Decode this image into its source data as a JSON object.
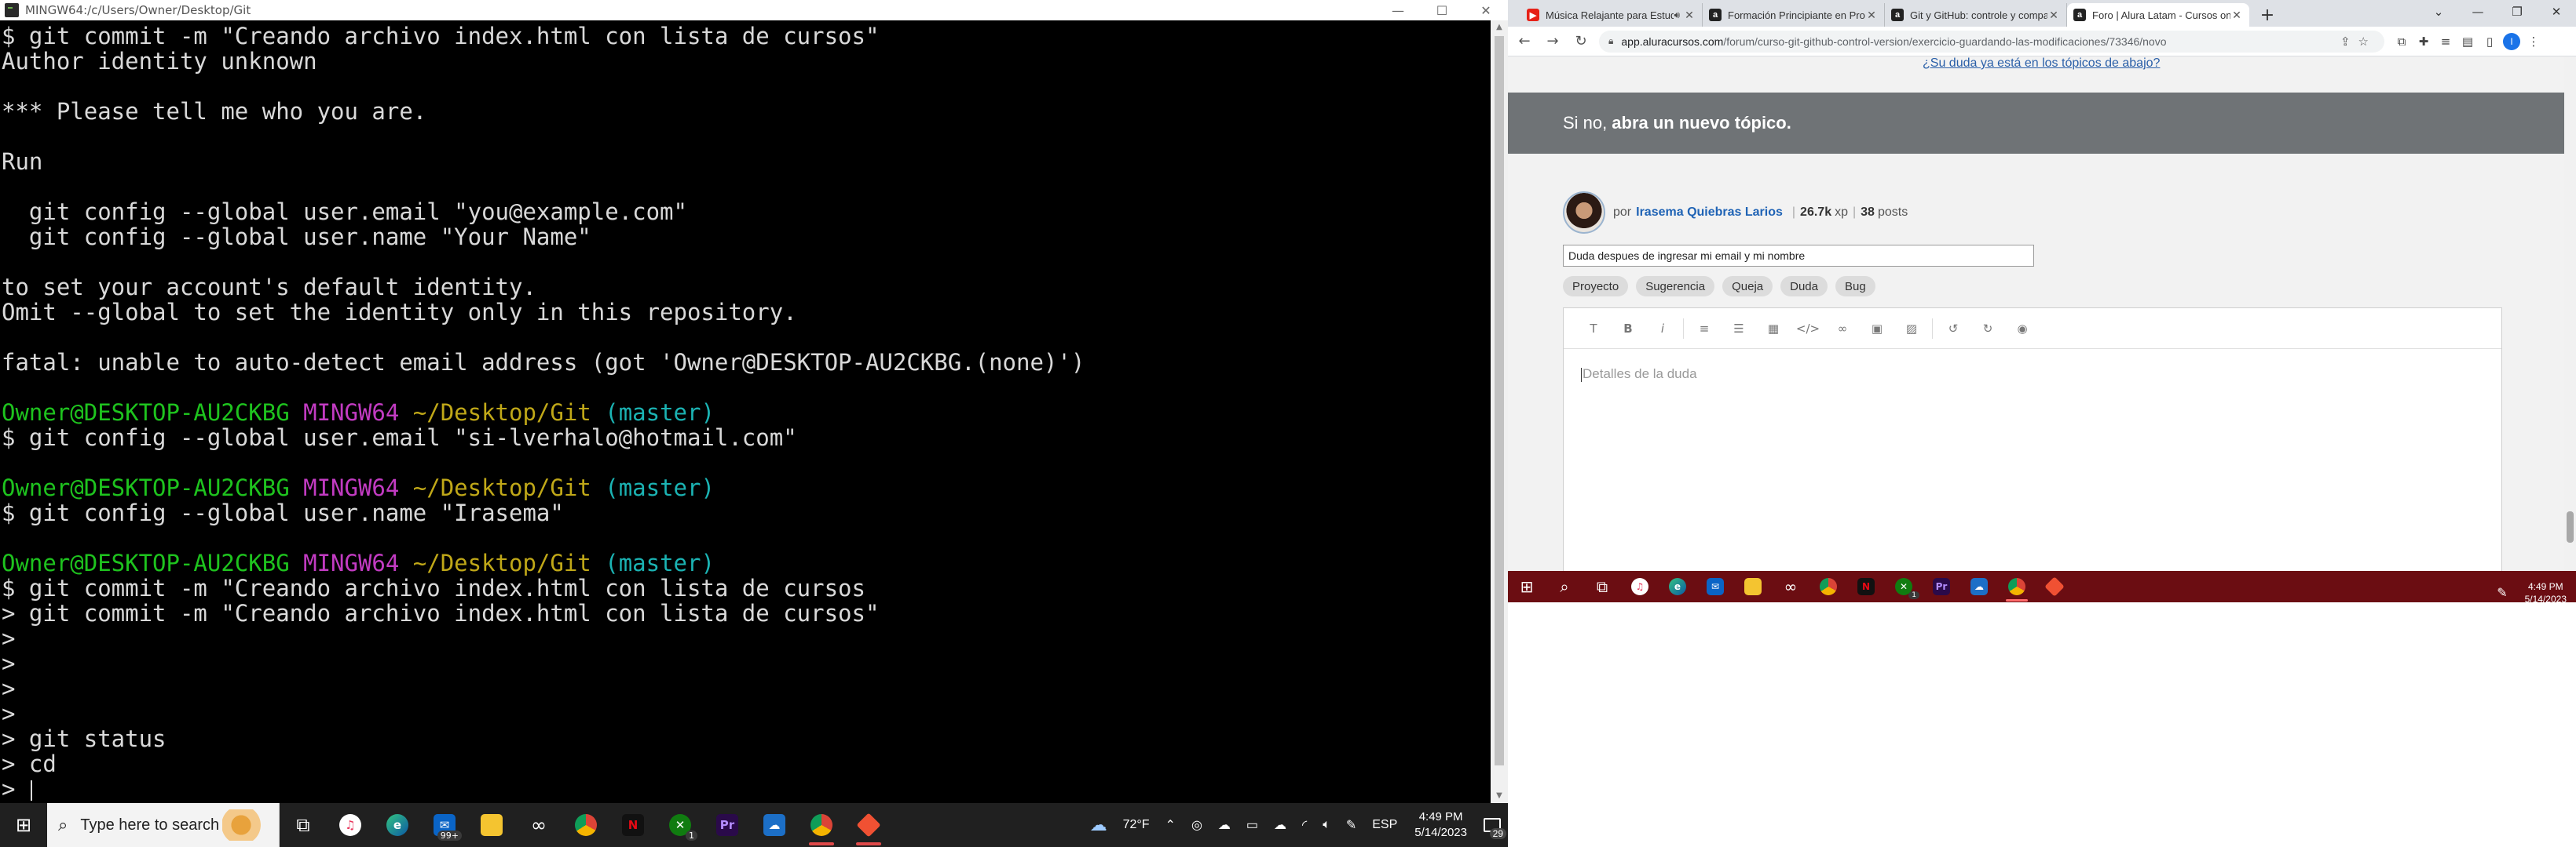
{
  "terminal": {
    "window_title": "MINGW64:/c/Users/Owner/Desktop/Git",
    "controls": {
      "minimize": "—",
      "maximize": "☐",
      "close": "✕"
    },
    "lines": [
      [
        {
          "t": "$ git commit -m \"Creando archivo index.html con lista de cursos\"",
          "c": ""
        }
      ],
      [
        {
          "t": "Author identity unknown",
          "c": ""
        }
      ],
      [
        {
          "t": "",
          "c": ""
        }
      ],
      [
        {
          "t": "*** Please tell me who you are.",
          "c": ""
        }
      ],
      [
        {
          "t": "",
          "c": ""
        }
      ],
      [
        {
          "t": "Run",
          "c": ""
        }
      ],
      [
        {
          "t": "",
          "c": ""
        }
      ],
      [
        {
          "t": "  git config --global user.email \"you@example.com\"",
          "c": ""
        }
      ],
      [
        {
          "t": "  git config --global user.name \"Your Name\"",
          "c": ""
        }
      ],
      [
        {
          "t": "",
          "c": ""
        }
      ],
      [
        {
          "t": "to set your account's default identity.",
          "c": ""
        }
      ],
      [
        {
          "t": "Omit --global to set the identity only in this repository.",
          "c": ""
        }
      ],
      [
        {
          "t": "",
          "c": ""
        }
      ],
      [
        {
          "t": "fatal: unable to auto-detect email address (got 'Owner@DESKTOP-AU2CKBG.(none)')",
          "c": ""
        }
      ],
      [
        {
          "t": "",
          "c": ""
        }
      ],
      [
        {
          "t": "Owner@DESKTOP-AU2CKBG ",
          "c": "c-green"
        },
        {
          "t": "MINGW64 ",
          "c": "c-mag"
        },
        {
          "t": "~/Desktop/Git ",
          "c": "c-yel"
        },
        {
          "t": "(master)",
          "c": "c-cyan"
        }
      ],
      [
        {
          "t": "$ git config --global user.email \"si-lverhalo@hotmail.com\"",
          "c": ""
        }
      ],
      [
        {
          "t": "",
          "c": ""
        }
      ],
      [
        {
          "t": "Owner@DESKTOP-AU2CKBG ",
          "c": "c-green"
        },
        {
          "t": "MINGW64 ",
          "c": "c-mag"
        },
        {
          "t": "~/Desktop/Git ",
          "c": "c-yel"
        },
        {
          "t": "(master)",
          "c": "c-cyan"
        }
      ],
      [
        {
          "t": "$ git config --global user.name \"Irasema\"",
          "c": ""
        }
      ],
      [
        {
          "t": "",
          "c": ""
        }
      ],
      [
        {
          "t": "Owner@DESKTOP-AU2CKBG ",
          "c": "c-green"
        },
        {
          "t": "MINGW64 ",
          "c": "c-mag"
        },
        {
          "t": "~/Desktop/Git ",
          "c": "c-yel"
        },
        {
          "t": "(master)",
          "c": "c-cyan"
        }
      ],
      [
        {
          "t": "$ git commit -m \"Creando archivo index.html con lista de cursos",
          "c": ""
        }
      ],
      [
        {
          "t": "> git commit -m \"Creando archivo index.html con lista de cursos\"",
          "c": ""
        }
      ],
      [
        {
          "t": ">",
          "c": ""
        }
      ],
      [
        {
          "t": ">",
          "c": ""
        }
      ],
      [
        {
          "t": ">",
          "c": ""
        }
      ],
      [
        {
          "t": ">",
          "c": ""
        }
      ],
      [
        {
          "t": "> git status",
          "c": ""
        }
      ],
      [
        {
          "t": "> cd",
          "c": ""
        }
      ],
      [
        {
          "t": "> ",
          "c": ""
        }
      ]
    ]
  },
  "taskbar_left": {
    "search_placeholder": "Type here to search",
    "mail_badge": "99+",
    "xbox_badge": "1",
    "weather": "72°F",
    "language": "ESP",
    "time": "4:49 PM",
    "date": "5/14/2023",
    "notifications": "29"
  },
  "browser": {
    "tabs": [
      {
        "title": "Música Relajante para Estudiar",
        "favicon": "youtube",
        "color": "#e62117",
        "letter": "▶"
      },
      {
        "title": "Formación Principiante en Programación",
        "favicon": "alura",
        "color": "#222222",
        "letter": "a"
      },
      {
        "title": "Git y GitHub: controle y comparta su código",
        "favicon": "alura",
        "color": "#222222",
        "letter": "a"
      },
      {
        "title": "Foro | Alura Latam - Cursos online de tecnología",
        "favicon": "alura",
        "color": "#222222",
        "letter": "a"
      }
    ],
    "url_host": "app.aluracursos.com",
    "url_path": "/forum/curso-git-github-control-version/exercicio-guardando-las-modificaciones/73346/novo",
    "profile_letter": "I"
  },
  "page": {
    "ask_link": "¿Su duda ya está en los tópicos de abajo?",
    "banner_prefix": "Si no,",
    "banner_bold": "abra un nuevo tópico.",
    "author_by": "por",
    "author_name": "Irasema Quiebras Larios",
    "author_xp_value": "26.7k",
    "author_xp_unit": "xp",
    "author_posts_value": "38",
    "author_posts_unit": "posts",
    "title_value": "Duda despues de ingresar mi email  y mi nombre",
    "tags": [
      "Proyecto",
      "Sugerencia",
      "Queja",
      "Duda",
      "Bug"
    ],
    "editor_placeholder": "Detalles de la duda"
  },
  "taskbar_right": {
    "time": "4:49 PM",
    "date": "5/14/2023",
    "xbox_badge": "1"
  }
}
